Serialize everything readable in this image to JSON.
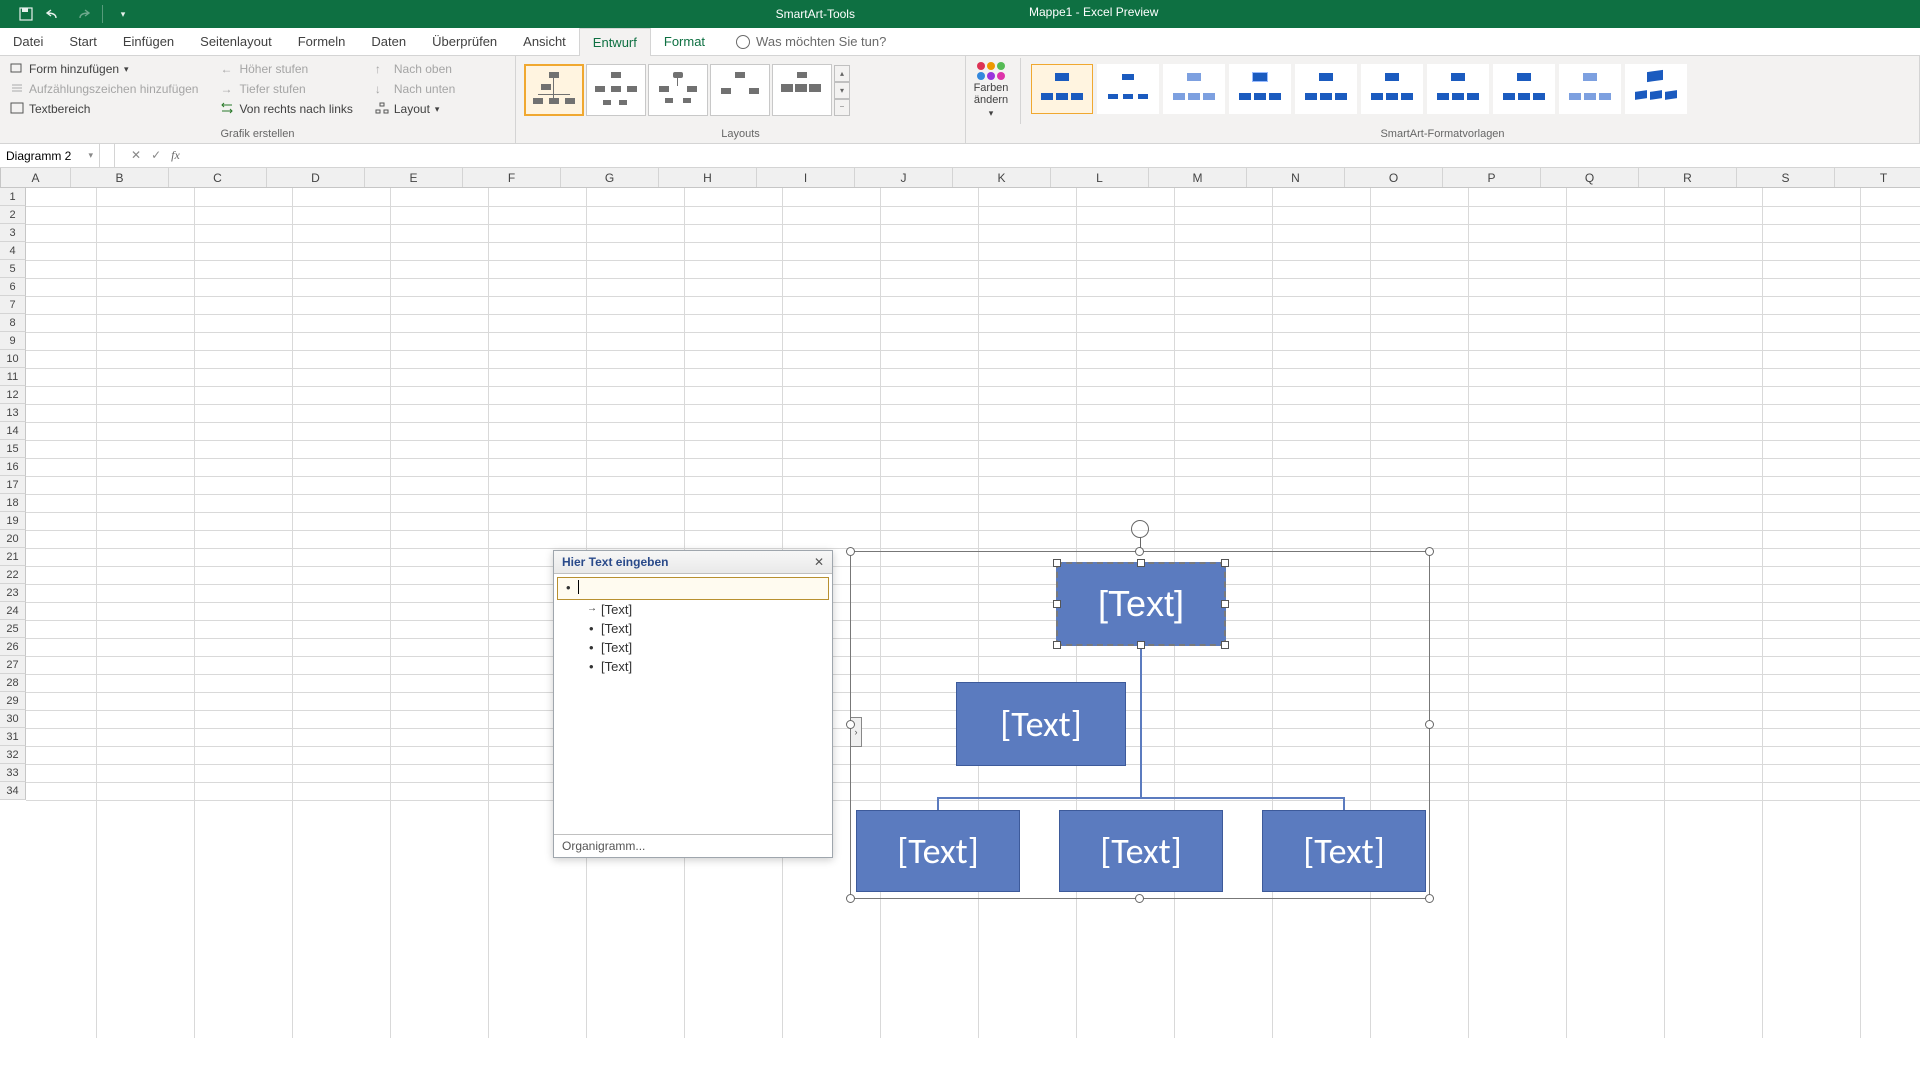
{
  "titlebar": {
    "tool_context": "SmartArt-Tools",
    "doc": "Mappe1 - Excel Preview"
  },
  "tabs": {
    "datei": "Datei",
    "start": "Start",
    "einfugen": "Einfügen",
    "seitenlayout": "Seitenlayout",
    "formeln": "Formeln",
    "daten": "Daten",
    "uberprufen": "Überprüfen",
    "ansicht": "Ansicht",
    "entwurf": "Entwurf",
    "format": "Format",
    "tellme": "Was möchten Sie tun?"
  },
  "ribbon": {
    "grafik": {
      "form_hinzufugen": "Form hinzufügen",
      "aufzahlung": "Aufzählungszeichen hinzufügen",
      "textbereich": "Textbereich",
      "hoher": "Höher stufen",
      "tiefer": "Tiefer stufen",
      "rtl": "Von rechts nach links",
      "nach_oben": "Nach oben",
      "nach_unten": "Nach unten",
      "layout": "Layout",
      "group_label": "Grafik erstellen"
    },
    "layouts_label": "Layouts",
    "farben": "Farben ändern",
    "styles_label": "SmartArt-Formatvorlagen"
  },
  "fx": {
    "name": "Diagramm 2"
  },
  "columns": [
    "A",
    "B",
    "C",
    "D",
    "E",
    "F",
    "G",
    "H",
    "I",
    "J",
    "K",
    "L",
    "M",
    "N",
    "O",
    "P",
    "Q",
    "R",
    "S",
    "T"
  ],
  "textpane": {
    "title": "Hier Text eingeben",
    "items": [
      "",
      "[Text]",
      "[Text]",
      "[Text]",
      "[Text]"
    ],
    "footer": "Organigramm..."
  },
  "smartart": {
    "placeholder": "[Text]"
  }
}
